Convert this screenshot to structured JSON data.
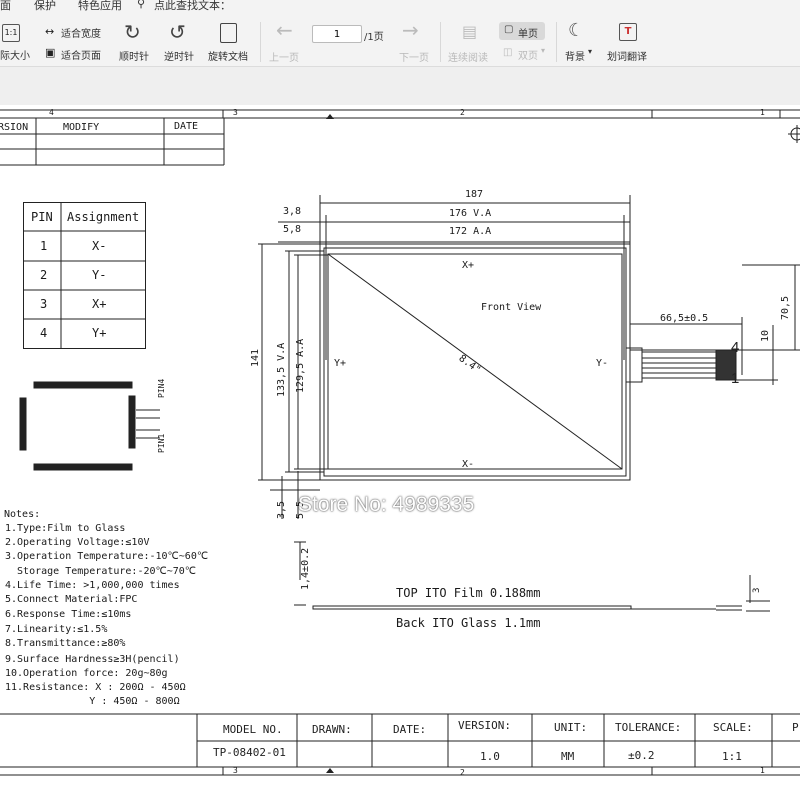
{
  "menu": {
    "items": [
      "面",
      "保护",
      "特色应用"
    ],
    "search_label": "点此查找文本："
  },
  "toolbar": {
    "actual_size_label": "际大小",
    "fit_width_label": "适合宽度",
    "fit_page_label": "适合页面",
    "rotate_cw_label": "顺时针",
    "rotate_ccw_label": "逆时针",
    "rotate_doc_label": "旋转文档",
    "prev_page_label": "上一页",
    "page_input_value": "1",
    "page_total": "/1页",
    "next_page_label": "下一页",
    "continuous_label": "连续阅读",
    "single_page_label": "单页",
    "double_page_label": "双页",
    "background_label": "背景",
    "translate_label": "划词翻译",
    "zoom_icon_text": "1:1"
  },
  "drawing": {
    "ruler_top": [
      "4",
      "3",
      "2",
      "1"
    ],
    "ruler_bottom": [
      "3",
      "2",
      "1"
    ],
    "revision_table": {
      "headers": [
        "RSION",
        "MODIFY",
        "DATE"
      ]
    },
    "pin_table": {
      "headers": [
        "PIN",
        "Assignment"
      ],
      "rows": [
        [
          "1",
          "X-"
        ],
        [
          "2",
          "Y-"
        ],
        [
          "3",
          "X+"
        ],
        [
          "4",
          "Y+"
        ]
      ]
    },
    "fpc_labels": [
      "PIN4",
      "PIN1"
    ],
    "dimensions": {
      "overall_width": "187",
      "va_width": "176 V.A",
      "aa_width": "172 A.A",
      "left_offset_1": "3,8",
      "left_offset_2": "5,8",
      "overall_height": "141",
      "va_height": "133,5 V.A",
      "aa_height": "129,5 A.A",
      "bottom_1": "3,5",
      "bottom_2": "5,5",
      "fpc_length": "66,5±0.5",
      "fpc_height": "70,5",
      "fpc_width": "10",
      "thickness": "1,4±0.2",
      "tail": "3"
    },
    "panel_labels": {
      "x_plus": "X+",
      "x_minus": "X-",
      "y_plus": "Y+",
      "y_minus": "Y-",
      "front_view": "Front View",
      "diagonal": "8.4\"",
      "fpc_pin4": "4",
      "fpc_pin1": "1"
    },
    "layers": {
      "top": "TOP ITO Film 0.188mm",
      "back": "Back ITO Glass 1.1mm"
    },
    "notes_title": "Notes:",
    "notes": [
      "1.Type:Film to Glass",
      "2.Operating Voltage:≤10V",
      "3.Operation Temperature:-10℃~60℃",
      "  Storage Temperature:-20℃~70℃",
      "4.Life Time: >1,000,000 times",
      "5.Connect Material:FPC",
      "6.Response Time:≤10ms",
      "7.Linearity:≤1.5%",
      "8.Transmittance:≥80%",
      "9.Surface Hardness≥3H(pencil)",
      "10.Operation force: 20g~80g",
      "11.Resistance: X : 200Ω - 450Ω",
      "              Y : 450Ω - 800Ω"
    ],
    "title_block": {
      "headers": [
        "MODEL NO.",
        "DRAWN:",
        "DATE:",
        "VERSION:",
        "UNIT:",
        "TOLERANCE:",
        "SCALE:",
        "P"
      ],
      "values": [
        "TP-08402-01",
        "",
        "",
        "1.0",
        "MM",
        "±0.2",
        "1:1",
        ""
      ]
    },
    "watermark": "Store No: 4989335"
  }
}
